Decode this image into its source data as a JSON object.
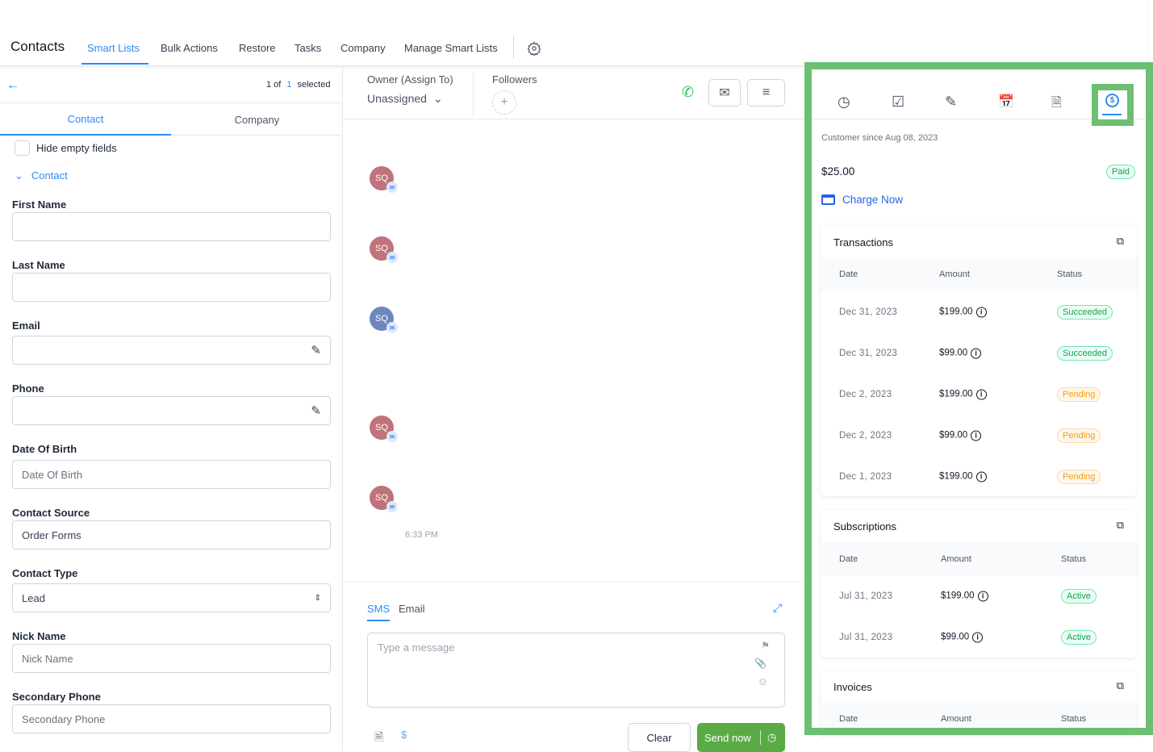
{
  "nav": {
    "title": "Contacts",
    "items": [
      "Smart Lists",
      "Bulk Actions",
      "Restore",
      "Tasks",
      "Company",
      "Manage Smart Lists"
    ],
    "active": "Smart Lists"
  },
  "left": {
    "count_prefix": "1 of",
    "count_num": "1",
    "count_suffix": "selected",
    "tabs": [
      "Contact",
      "Company"
    ],
    "hide_empty": "Hide empty fields",
    "section": "Contact",
    "fields": [
      {
        "label": "First Name",
        "value": "",
        "placeholder": ""
      },
      {
        "label": "Last Name",
        "value": "",
        "placeholder": ""
      },
      {
        "label": "Email",
        "value": "",
        "placeholder": ""
      },
      {
        "label": "Phone",
        "value": "",
        "placeholder": ""
      },
      {
        "label": "Date Of Birth",
        "value": "",
        "placeholder": "Date Of Birth"
      },
      {
        "label": "Contact Source",
        "value": "Order Forms",
        "placeholder": ""
      },
      {
        "label": "Contact Type",
        "value": "Lead",
        "placeholder": ""
      },
      {
        "label": "Nick Name",
        "value": "",
        "placeholder": "Nick Name"
      },
      {
        "label": "Secondary Phone",
        "value": "",
        "placeholder": "Secondary Phone"
      }
    ]
  },
  "mid": {
    "owner_label": "Owner (Assign To)",
    "owner_value": "Unassigned",
    "followers_label": "Followers",
    "avatar_initials": "SQ",
    "time": "6:33 PM",
    "compose_tabs": [
      "SMS",
      "Email"
    ],
    "message_placeholder": "Type a message",
    "clear": "Clear",
    "send": "Send now"
  },
  "right": {
    "customer_since": "Customer since Aug 08, 2023",
    "balance": "$25.00",
    "balance_status": "Paid",
    "charge_now": "Charge Now",
    "transactions": {
      "title": "Transactions",
      "headers": [
        "Date",
        "Amount",
        "Status"
      ],
      "rows": [
        [
          "Dec 31, 2023",
          "$199.00",
          "Succeeded"
        ],
        [
          "Dec 31, 2023",
          "$99.00",
          "Succeeded"
        ],
        [
          "Dec 2, 2023",
          "$199.00",
          "Pending"
        ],
        [
          "Dec 2, 2023",
          "$99.00",
          "Pending"
        ],
        [
          "Dec 1, 2023",
          "$199.00",
          "Pending"
        ]
      ]
    },
    "subscriptions": {
      "title": "Subscriptions",
      "headers": [
        "Date",
        "Amount",
        "Status"
      ],
      "rows": [
        [
          "Jul 31, 2023",
          "$199.00",
          "Active"
        ],
        [
          "Jul 31, 2023",
          "$99.00",
          "Active"
        ]
      ]
    },
    "invoices": {
      "title": "Invoices",
      "headers": [
        "Date",
        "Amount",
        "Status"
      ]
    }
  },
  "colors": {
    "accent": "#2d8cf0",
    "highlight": "#6dbf73",
    "send": "#5aab46",
    "avatar_red": "#c0737a",
    "avatar_blue": "#6f86bf"
  }
}
